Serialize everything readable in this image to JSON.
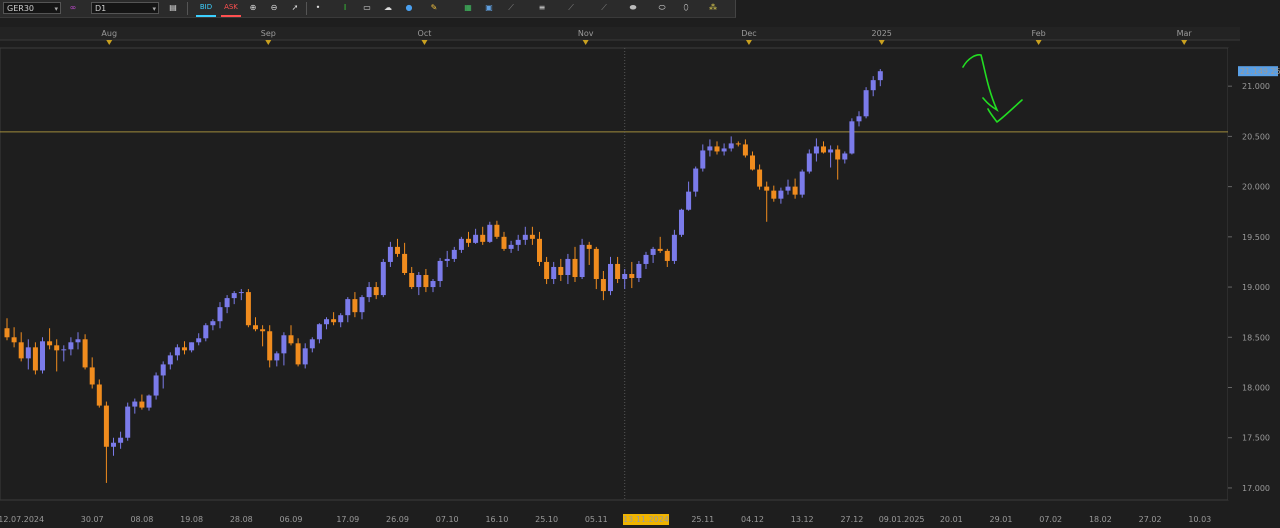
{
  "toolbar": {
    "symbol": "GER30",
    "timeframe": "D1",
    "bid_label": "BID",
    "ask_label": "ASK",
    "icons": [
      "bars-icon",
      "link-icon",
      "chart-type-icon",
      "zoom-in-icon",
      "zoom-out-icon",
      "cursor-icon",
      "dot-icon",
      "trendline-icon",
      "note-icon",
      "cloud-icon",
      "globe-icon",
      "pencil-icon",
      "indicator-icon",
      "template-icon",
      "fib-icon",
      "channel-icon",
      "pitchfork-icon",
      "gann-icon",
      "ellipse-icon",
      "eraser-icon",
      "settings-icon"
    ]
  },
  "colors": {
    "background": "#1e1e1e",
    "bull": "#7b7bea",
    "bear": "#f08c1e",
    "hline": "#a08c3c",
    "annotation": "#22dd22",
    "price_tag": "#5aa0e6",
    "date_highlight": "#f0b400"
  },
  "chart_data": {
    "type": "candlestick",
    "symbol": "GER30",
    "timeframe": "D1",
    "ylim": [
      16880,
      21380
    ],
    "yticks": [
      17000,
      17500,
      18000,
      18500,
      19000,
      19500,
      20000,
      20500,
      21000
    ],
    "ytick_labels": [
      "17.000",
      "17.500",
      "18.000",
      "18.500",
      "19.000",
      "19.500",
      "20.000",
      "20.500",
      "21.000"
    ],
    "current_price_label": "21.149,25",
    "current_price": 21149.25,
    "horizontal_line": 20545,
    "crosshair_date_label": "13.11.2024",
    "crosshair_index": 87,
    "month_labels": [
      {
        "label": "Aug",
        "index": 14.4
      },
      {
        "label": "Sep",
        "index": 36.8
      },
      {
        "label": "Oct",
        "index": 58.8
      },
      {
        "label": "Nov",
        "index": 81.5
      },
      {
        "label": "Dec",
        "index": 104.5
      },
      {
        "label": "2025",
        "index": 123.2
      },
      {
        "label": "Feb",
        "index": 145.3
      },
      {
        "label": "Mar",
        "index": 165.8
      }
    ],
    "date_labels": [
      {
        "label": "12.07.2024",
        "index": 2
      },
      {
        "label": "30.07",
        "index": 12
      },
      {
        "label": "08.08",
        "index": 19
      },
      {
        "label": "19.08",
        "index": 26
      },
      {
        "label": "28.08",
        "index": 33
      },
      {
        "label": "06.09",
        "index": 40
      },
      {
        "label": "17.09",
        "index": 48
      },
      {
        "label": "26.09",
        "index": 55
      },
      {
        "label": "07.10",
        "index": 62
      },
      {
        "label": "16.10",
        "index": 69
      },
      {
        "label": "25.10",
        "index": 76
      },
      {
        "label": "05.11",
        "index": 83
      },
      {
        "label": "13.11.2024",
        "index": 90
      },
      {
        "label": "25.11",
        "index": 98
      },
      {
        "label": "04.12",
        "index": 105
      },
      {
        "label": "13.12",
        "index": 112
      },
      {
        "label": "27.12",
        "index": 119
      },
      {
        "label": "09.01.2025",
        "index": 126
      },
      {
        "label": "20.01",
        "index": 133
      },
      {
        "label": "29.01",
        "index": 140
      },
      {
        "label": "07.02",
        "index": 147
      },
      {
        "label": "18.02",
        "index": 154
      },
      {
        "label": "27.02",
        "index": 161
      },
      {
        "label": "10.03",
        "index": 168
      }
    ],
    "candles": [
      [
        18590,
        18690,
        18470,
        18500
      ],
      [
        18500,
        18600,
        18400,
        18450
      ],
      [
        18450,
        18550,
        18260,
        18290
      ],
      [
        18290,
        18480,
        18180,
        18400
      ],
      [
        18400,
        18450,
        18130,
        18170
      ],
      [
        18170,
        18500,
        18140,
        18460
      ],
      [
        18460,
        18590,
        18380,
        18420
      ],
      [
        18420,
        18480,
        18160,
        18370
      ],
      [
        18370,
        18420,
        18260,
        18380
      ],
      [
        18380,
        18500,
        18320,
        18450
      ],
      [
        18450,
        18550,
        18380,
        18480
      ],
      [
        18480,
        18530,
        18180,
        18200
      ],
      [
        18200,
        18300,
        17990,
        18030
      ],
      [
        18030,
        18080,
        17800,
        17820
      ],
      [
        17820,
        17860,
        17050,
        17410
      ],
      [
        17410,
        17500,
        17320,
        17450
      ],
      [
        17450,
        17560,
        17390,
        17500
      ],
      [
        17500,
        17850,
        17470,
        17810
      ],
      [
        17810,
        17890,
        17740,
        17860
      ],
      [
        17860,
        17930,
        17780,
        17800
      ],
      [
        17800,
        17930,
        17770,
        17920
      ],
      [
        17920,
        18150,
        17880,
        18120
      ],
      [
        18120,
        18260,
        17990,
        18230
      ],
      [
        18230,
        18350,
        18180,
        18320
      ],
      [
        18320,
        18430,
        18270,
        18400
      ],
      [
        18400,
        18460,
        18330,
        18370
      ],
      [
        18370,
        18450,
        18350,
        18450
      ],
      [
        18450,
        18540,
        18420,
        18490
      ],
      [
        18490,
        18640,
        18460,
        18620
      ],
      [
        18620,
        18680,
        18570,
        18660
      ],
      [
        18660,
        18850,
        18590,
        18800
      ],
      [
        18800,
        18920,
        18740,
        18890
      ],
      [
        18890,
        18960,
        18830,
        18940
      ],
      [
        18940,
        18980,
        18870,
        18950
      ],
      [
        18950,
        18980,
        18600,
        18620
      ],
      [
        18620,
        18700,
        18560,
        18580
      ],
      [
        18580,
        18620,
        18410,
        18560
      ],
      [
        18560,
        18620,
        18200,
        18270
      ],
      [
        18270,
        18360,
        18210,
        18340
      ],
      [
        18340,
        18550,
        18220,
        18520
      ],
      [
        18520,
        18620,
        18420,
        18440
      ],
      [
        18440,
        18490,
        18210,
        18230
      ],
      [
        18230,
        18440,
        18190,
        18390
      ],
      [
        18390,
        18500,
        18350,
        18480
      ],
      [
        18480,
        18640,
        18440,
        18630
      ],
      [
        18630,
        18700,
        18580,
        18680
      ],
      [
        18680,
        18750,
        18620,
        18650
      ],
      [
        18650,
        18740,
        18600,
        18720
      ],
      [
        18720,
        18900,
        18650,
        18880
      ],
      [
        18880,
        18950,
        18700,
        18750
      ],
      [
        18750,
        18920,
        18680,
        18900
      ],
      [
        18900,
        19050,
        18850,
        19000
      ],
      [
        19000,
        19050,
        18880,
        18920
      ],
      [
        18920,
        19280,
        18900,
        19250
      ],
      [
        19250,
        19450,
        19200,
        19400
      ],
      [
        19400,
        19480,
        19300,
        19330
      ],
      [
        19330,
        19440,
        19120,
        19140
      ],
      [
        19140,
        19200,
        18980,
        19000
      ],
      [
        19000,
        19150,
        18920,
        19120
      ],
      [
        19120,
        19180,
        18950,
        19000
      ],
      [
        19000,
        19080,
        18950,
        19060
      ],
      [
        19060,
        19290,
        19000,
        19260
      ],
      [
        19260,
        19360,
        19200,
        19280
      ],
      [
        19280,
        19400,
        19250,
        19370
      ],
      [
        19370,
        19500,
        19340,
        19480
      ],
      [
        19480,
        19550,
        19400,
        19440
      ],
      [
        19440,
        19580,
        19430,
        19520
      ],
      [
        19520,
        19600,
        19420,
        19450
      ],
      [
        19450,
        19650,
        19440,
        19620
      ],
      [
        19620,
        19660,
        19480,
        19500
      ],
      [
        19500,
        19550,
        19360,
        19380
      ],
      [
        19380,
        19460,
        19340,
        19420
      ],
      [
        19420,
        19520,
        19360,
        19470
      ],
      [
        19470,
        19600,
        19420,
        19520
      ],
      [
        19520,
        19600,
        19420,
        19480
      ],
      [
        19480,
        19550,
        19210,
        19250
      ],
      [
        19250,
        19300,
        19030,
        19080
      ],
      [
        19080,
        19250,
        19030,
        19200
      ],
      [
        19200,
        19280,
        19060,
        19120
      ],
      [
        19120,
        19330,
        19030,
        19280
      ],
      [
        19280,
        19400,
        19050,
        19100
      ],
      [
        19100,
        19480,
        19080,
        19420
      ],
      [
        19420,
        19450,
        19220,
        19380
      ],
      [
        19380,
        19400,
        18980,
        19080
      ],
      [
        19080,
        19160,
        18870,
        18960
      ],
      [
        18960,
        19300,
        18920,
        19230
      ],
      [
        19230,
        19300,
        19040,
        19080
      ],
      [
        19080,
        19180,
        18980,
        19130
      ],
      [
        19130,
        19250,
        18990,
        19090
      ],
      [
        19090,
        19260,
        19050,
        19230
      ],
      [
        19230,
        19350,
        19180,
        19320
      ],
      [
        19320,
        19400,
        19240,
        19380
      ],
      [
        19380,
        19500,
        19340,
        19360
      ],
      [
        19360,
        19380,
        19200,
        19260
      ],
      [
        19260,
        19570,
        19230,
        19520
      ],
      [
        19520,
        19780,
        19500,
        19770
      ],
      [
        19770,
        20050,
        19760,
        19950
      ],
      [
        19950,
        20200,
        19900,
        20180
      ],
      [
        20180,
        20420,
        20150,
        20360
      ],
      [
        20360,
        20470,
        20300,
        20400
      ],
      [
        20400,
        20450,
        20320,
        20350
      ],
      [
        20350,
        20430,
        20310,
        20380
      ],
      [
        20380,
        20500,
        20350,
        20430
      ],
      [
        20430,
        20450,
        20400,
        20420
      ],
      [
        20420,
        20470,
        20290,
        20310
      ],
      [
        20310,
        20350,
        20160,
        20170
      ],
      [
        20170,
        20220,
        19970,
        20000
      ],
      [
        20000,
        20050,
        19650,
        19960
      ],
      [
        19960,
        20010,
        19850,
        19880
      ],
      [
        19880,
        19990,
        19830,
        19960
      ],
      [
        19960,
        20070,
        19920,
        20000
      ],
      [
        20000,
        20080,
        19880,
        19920
      ],
      [
        19920,
        20170,
        19890,
        20150
      ],
      [
        20150,
        20370,
        20130,
        20330
      ],
      [
        20330,
        20480,
        20250,
        20400
      ],
      [
        20400,
        20450,
        20330,
        20340
      ],
      [
        20340,
        20410,
        20190,
        20370
      ],
      [
        20370,
        20410,
        20070,
        20270
      ],
      [
        20270,
        20350,
        20230,
        20330
      ],
      [
        20330,
        20680,
        20320,
        20650
      ],
      [
        20650,
        20750,
        20600,
        20700
      ],
      [
        20700,
        20990,
        20680,
        20960
      ],
      [
        20960,
        21100,
        20900,
        21060
      ],
      [
        21060,
        21170,
        21000,
        21149
      ]
    ]
  }
}
